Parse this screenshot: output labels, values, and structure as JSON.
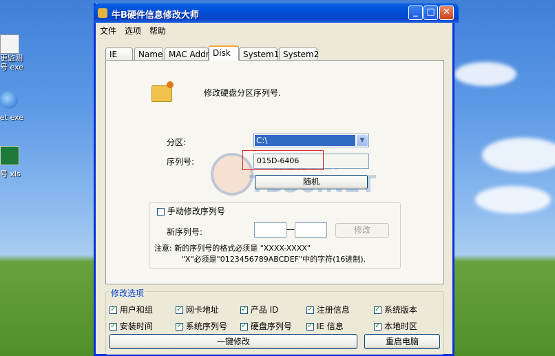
{
  "desktop": {
    "icons": [
      {
        "label1": "更监测",
        "label2": "号 exe"
      },
      {
        "label1": "et exe",
        "label2": ""
      },
      {
        "label1": "号 xls",
        "label2": ""
      }
    ]
  },
  "window": {
    "title": "牛B硬件信息修改大师",
    "controls": {
      "minimize": "_",
      "maximize": "□",
      "close": "✕"
    }
  },
  "menu": [
    "文件",
    "选项",
    "帮助"
  ],
  "tabs": [
    "IE",
    "Name",
    "MAC Addr",
    "Disk",
    "System1",
    "System2"
  ],
  "active_tab": "Disk",
  "disk_panel": {
    "description": "修改硬盘分区序列号.",
    "partition_label": "分区:",
    "partition_value": "C:\\",
    "serial_label": "序列号:",
    "serial_value": "015D-6406",
    "random_button": "随机",
    "manual": {
      "checkbox_label": "手动修改序列号",
      "checked": false,
      "new_serial_label": "新序列号:",
      "separator": "—",
      "part1": "",
      "part2": "",
      "modify_button": "修改",
      "note_line1": "注意: 新的序列号的格式必须是 \"XXXX-XXXX\"",
      "note_line2": "\"X\"必须是\"0123456789ABCDEF\"中的字符(16进制)."
    }
  },
  "watermark": {
    "line1": "安 德  分 享  进 步",
    "line2": "TB56.NET"
  },
  "options": {
    "title": "修改选项",
    "row1": [
      {
        "label": "用户和组",
        "checked": true
      },
      {
        "label": "网卡地址",
        "checked": true
      },
      {
        "label": "产品 ID",
        "checked": true
      },
      {
        "label": "注册信息",
        "checked": true
      },
      {
        "label": "系统版本",
        "checked": true
      }
    ],
    "row2": [
      {
        "label": "安装时间",
        "checked": true
      },
      {
        "label": "系统序列号",
        "checked": true
      },
      {
        "label": "硬盘序列号",
        "checked": true
      },
      {
        "label": "IE 信息",
        "checked": true
      },
      {
        "label": "本地时区",
        "checked": true
      }
    ],
    "apply_all_button": "一键修改",
    "restart_button": "重启电脑"
  }
}
